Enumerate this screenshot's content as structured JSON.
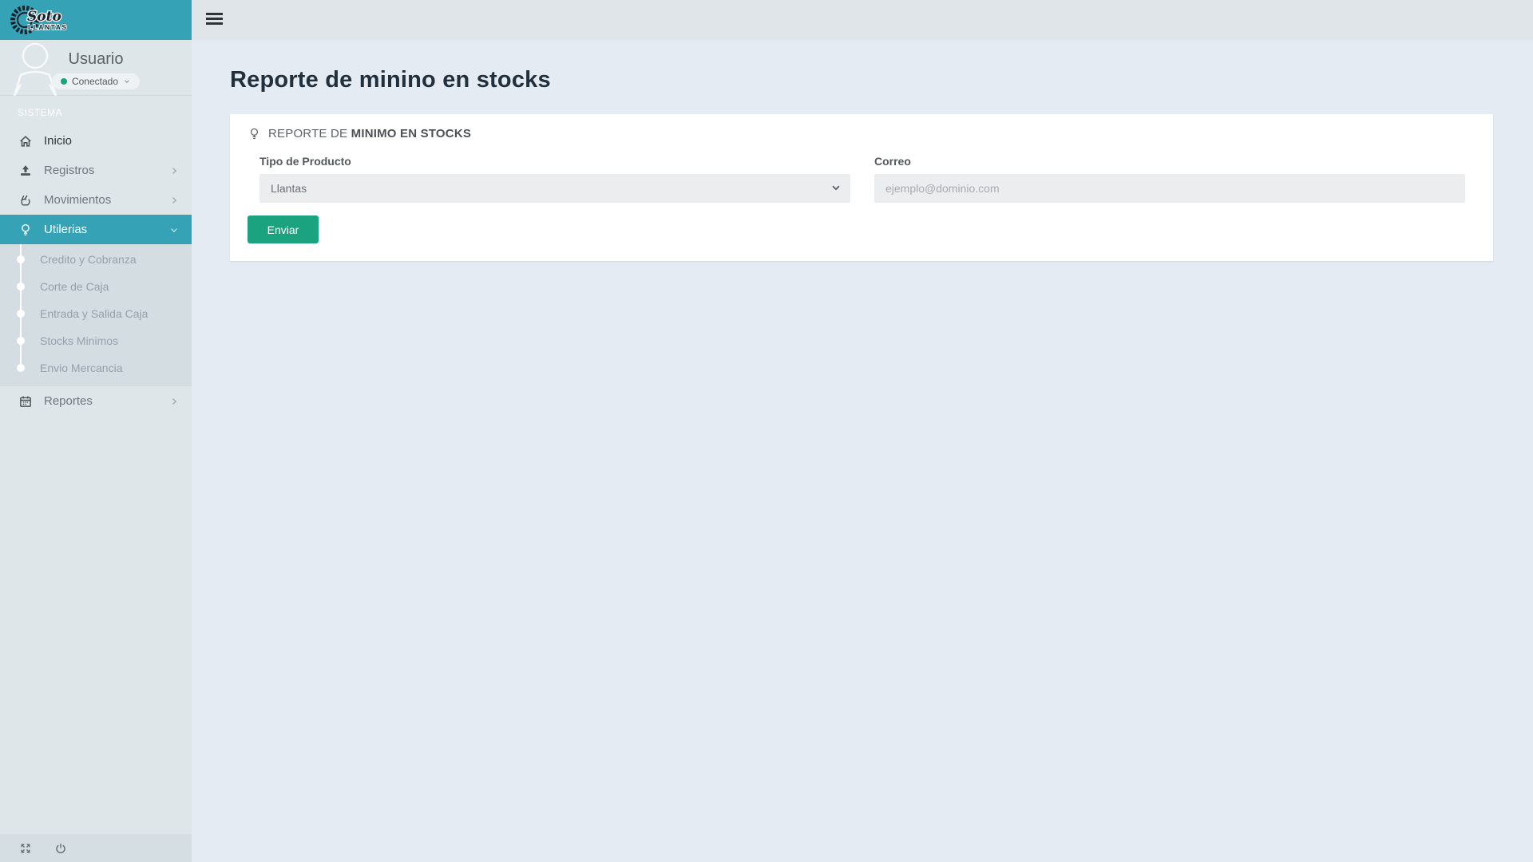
{
  "brand": {
    "script": "Soto",
    "block": "LLANTAS"
  },
  "user": {
    "name": "Usuario",
    "status": "Conectado"
  },
  "sidebar": {
    "section_label": "SISTEMA",
    "items": [
      {
        "label": "Inicio",
        "icon": "home-icon"
      },
      {
        "label": "Registros",
        "icon": "upload-icon"
      },
      {
        "label": "Movimientos",
        "icon": "hand-icon"
      },
      {
        "label": "Utilerias",
        "icon": "lightbulb-icon",
        "active": true
      },
      {
        "label": "Reportes",
        "icon": "calendar-icon"
      }
    ],
    "submenu": [
      "Credito y Cobranza",
      "Corte de Caja",
      "Entrada y Salida Caja",
      "Stocks Minimos",
      "Envio Mercancia"
    ],
    "footer_icons": [
      "expand-icon",
      "power-icon"
    ]
  },
  "page": {
    "title": "Reporte de minino en stocks"
  },
  "panel": {
    "header_prefix": "REPORTE DE ",
    "header_strong": "MINIMO EN STOCKS",
    "form": {
      "tipo_label": "Tipo de Producto",
      "tipo_value": "Llantas",
      "correo_label": "Correo",
      "correo_placeholder": "ejemplo@dominio.com",
      "submit_label": "Enviar"
    }
  },
  "colors": {
    "teal": "#35a2b5",
    "green": "#1aa37e",
    "sidebar_bg": "#dfe6e9",
    "submenu_bg": "#d3dde2",
    "main_bg": "#e5ebf2",
    "heading": "#22303d"
  }
}
